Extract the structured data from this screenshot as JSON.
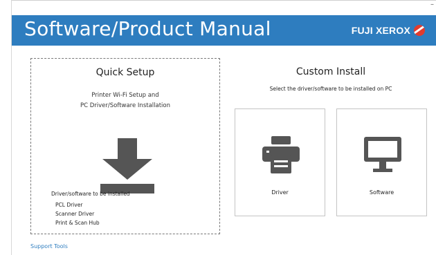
{
  "window": {
    "minimize_glyph": "–"
  },
  "header": {
    "title": "Software/Product Manual",
    "brand": "FUJI XEROX",
    "brand_color": "#2e7dbf",
    "logo_color": "#e23b2e"
  },
  "quick_setup": {
    "title": "Quick Setup",
    "subtitle_line1": "Printer Wi-Fi Setup and",
    "subtitle_line2": "PC Driver/Software Installation",
    "icon": "download-icon",
    "list_title": "Driver/software to be installed",
    "items": [
      "PCL Driver",
      "Scanner Driver",
      "Print & Scan Hub"
    ]
  },
  "custom_install": {
    "title": "Custom Install",
    "subtitle": "Select the driver/software to be installed on PC",
    "cards": [
      {
        "label": "Driver",
        "icon": "printer-icon"
      },
      {
        "label": "Software",
        "icon": "monitor-icon"
      }
    ]
  },
  "footer": {
    "support_link": "Support Tools"
  }
}
